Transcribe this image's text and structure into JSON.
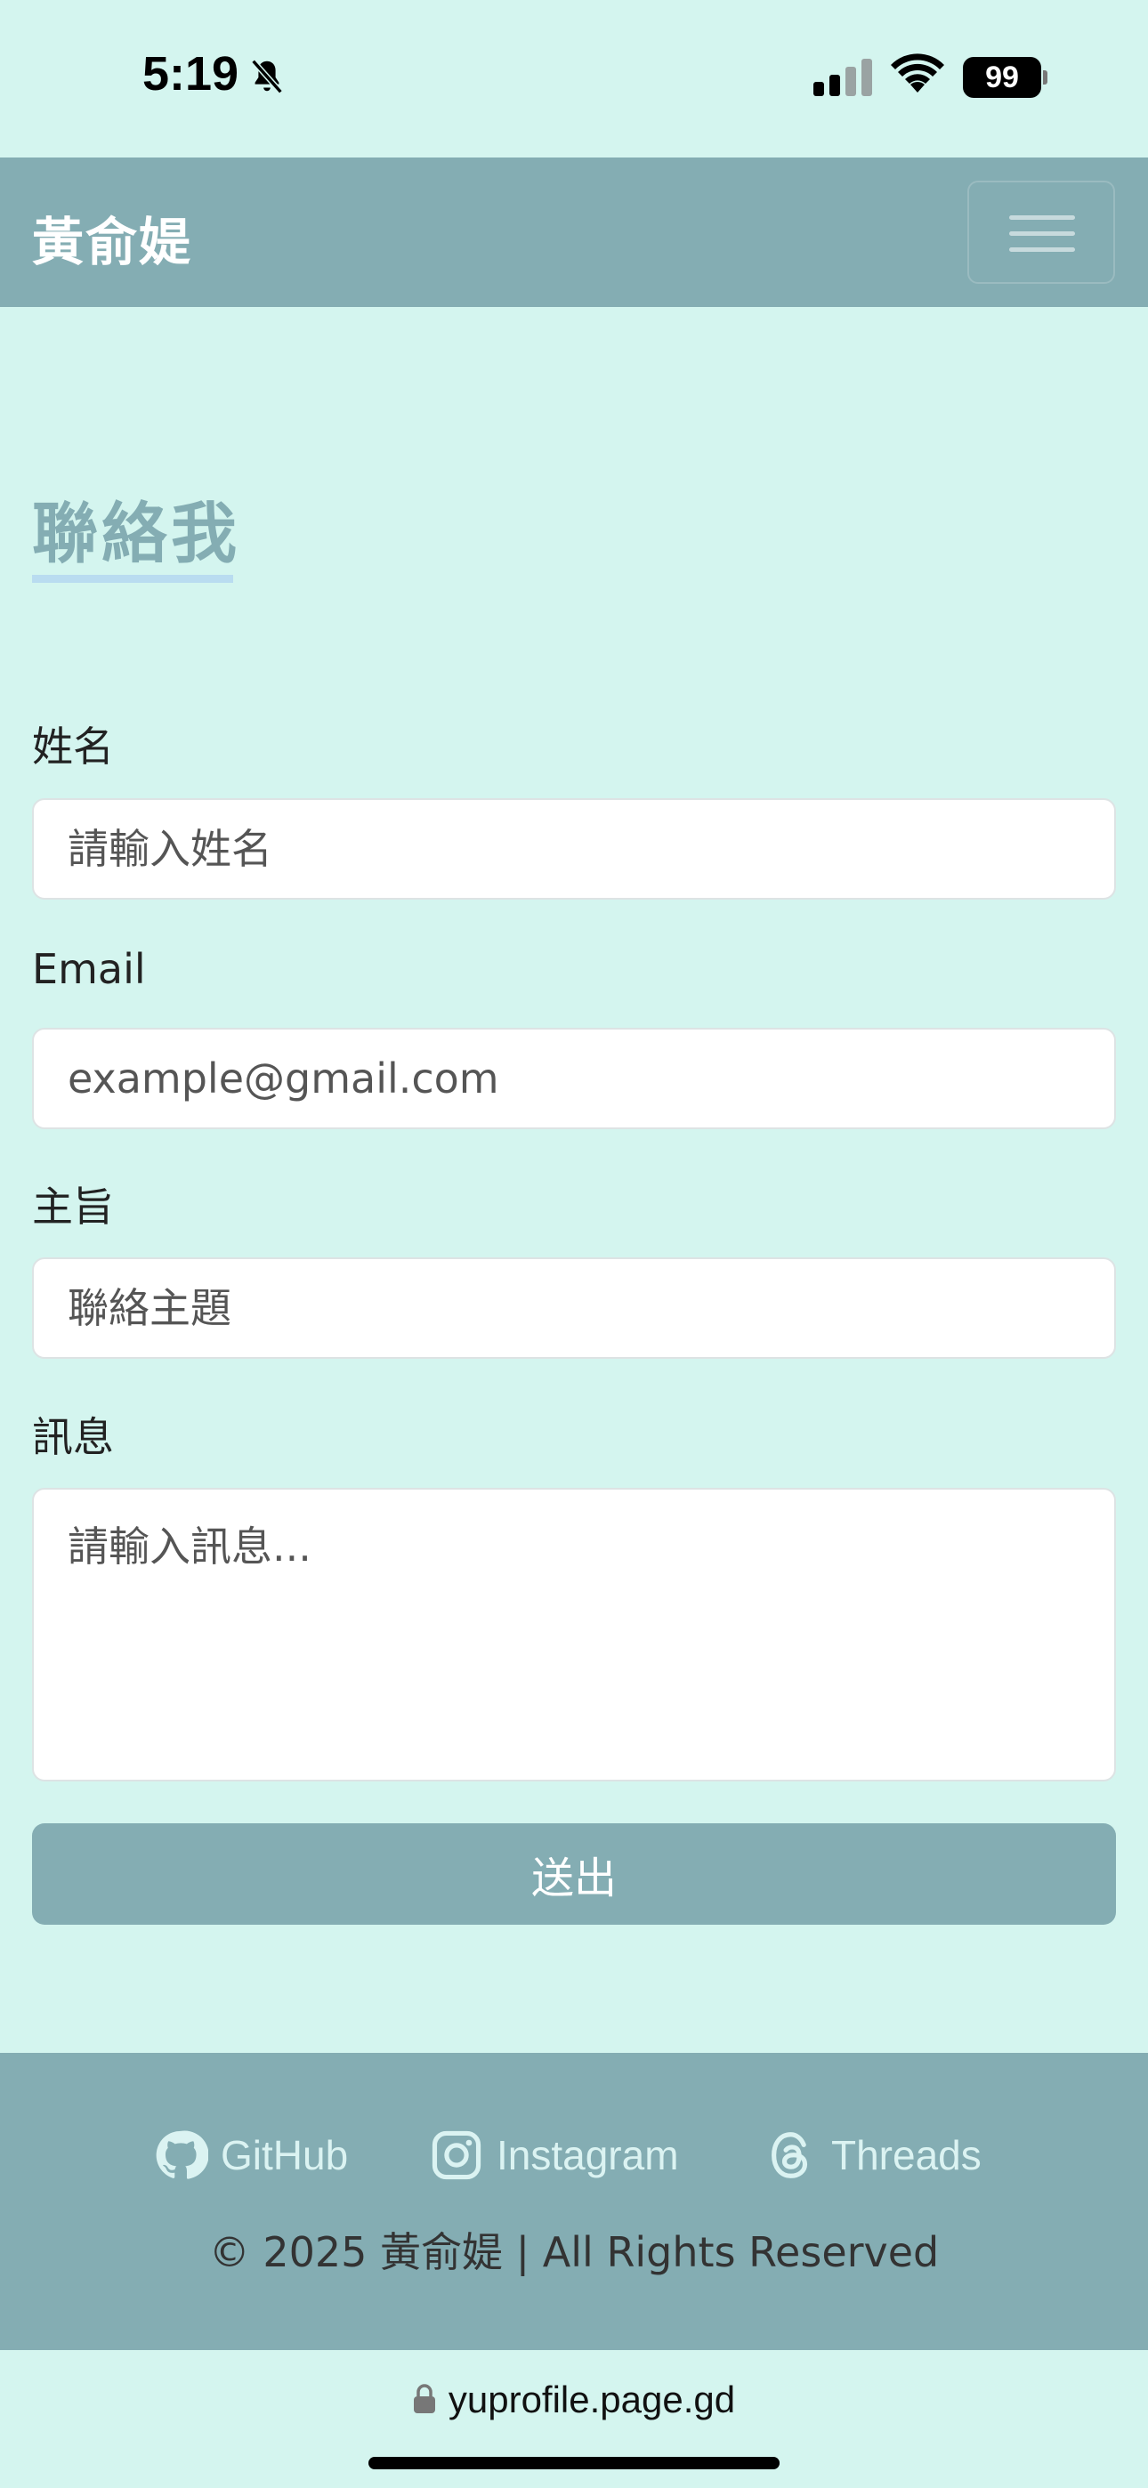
{
  "status_bar": {
    "time": "5:19",
    "battery": "99"
  },
  "navbar": {
    "brand": "黃俞媞"
  },
  "page": {
    "title": "聯絡我"
  },
  "form": {
    "name_label": "姓名",
    "name_placeholder": "請輸入姓名",
    "email_label": "Email",
    "email_placeholder": "example@gmail.com",
    "subject_label": "主旨",
    "subject_placeholder": "聯絡主題",
    "message_label": "訊息",
    "message_placeholder": "請輸入訊息...",
    "submit_label": "送出"
  },
  "footer": {
    "links": [
      {
        "label": "GitHub",
        "icon": "github-icon"
      },
      {
        "label": "Instagram",
        "icon": "instagram-icon"
      },
      {
        "label": "Threads",
        "icon": "threads-icon"
      }
    ],
    "copyright": "© 2025 黃俞媞 | All Rights Reserved"
  },
  "browser": {
    "url": "yuprofile.page.gd"
  },
  "colors": {
    "background": "#d4f5ef",
    "primary": "#84adb3",
    "underline": "#b9dcf0"
  }
}
